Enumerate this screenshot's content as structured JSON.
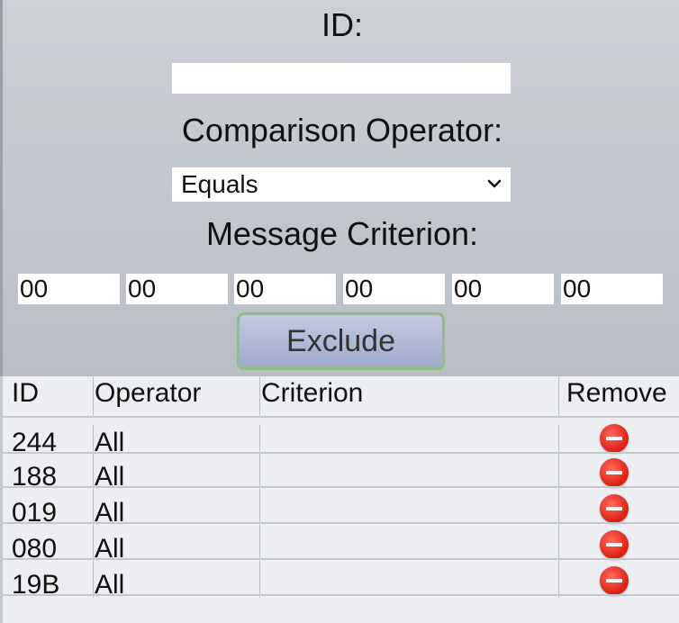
{
  "form": {
    "id_label": "ID:",
    "id_value": "",
    "operator_label": "Comparison Operator:",
    "operator_selected": "Equals",
    "criterion_label": "Message Criterion:",
    "criterion_bytes": [
      "00",
      "00",
      "00",
      "00",
      "00",
      "00"
    ],
    "exclude_label": "Exclude"
  },
  "table": {
    "headers": {
      "id": "ID",
      "operator": "Operator",
      "criterion": "Criterion",
      "remove": "Remove"
    },
    "rows": [
      {
        "id": "244",
        "operator": "All",
        "criterion": ""
      },
      {
        "id": "188",
        "operator": "All",
        "criterion": ""
      },
      {
        "id": "019",
        "operator": "All",
        "criterion": ""
      },
      {
        "id": "080",
        "operator": "All",
        "criterion": ""
      },
      {
        "id": "19B",
        "operator": "All",
        "criterion": ""
      }
    ]
  },
  "icons": {
    "remove": "remove-icon",
    "dropdown": "chevron-down-icon"
  },
  "colors": {
    "remove_red": "#e0271c",
    "button_border": "#8fbf86",
    "button_fill": "#aeb8d5"
  }
}
